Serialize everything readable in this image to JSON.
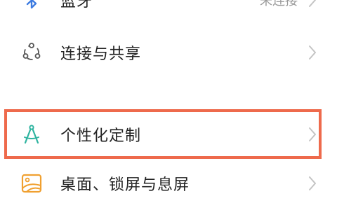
{
  "settings": {
    "items": [
      {
        "label": "蓝牙",
        "value": "未连接",
        "icon": "bluetooth-icon"
      },
      {
        "label": "连接与共享",
        "icon": "connection-share-icon"
      },
      {
        "label": "个性化定制",
        "icon": "personalization-compass-icon"
      },
      {
        "label": "桌面、锁屏与息屏",
        "icon": "wallpaper-icon"
      }
    ]
  },
  "colors": {
    "highlight_border": "#ee6a4c",
    "bluetooth_icon": "#3d7be0",
    "personalization_icon": "#2fb4a0",
    "wallpaper_icon": "#f0a030"
  }
}
